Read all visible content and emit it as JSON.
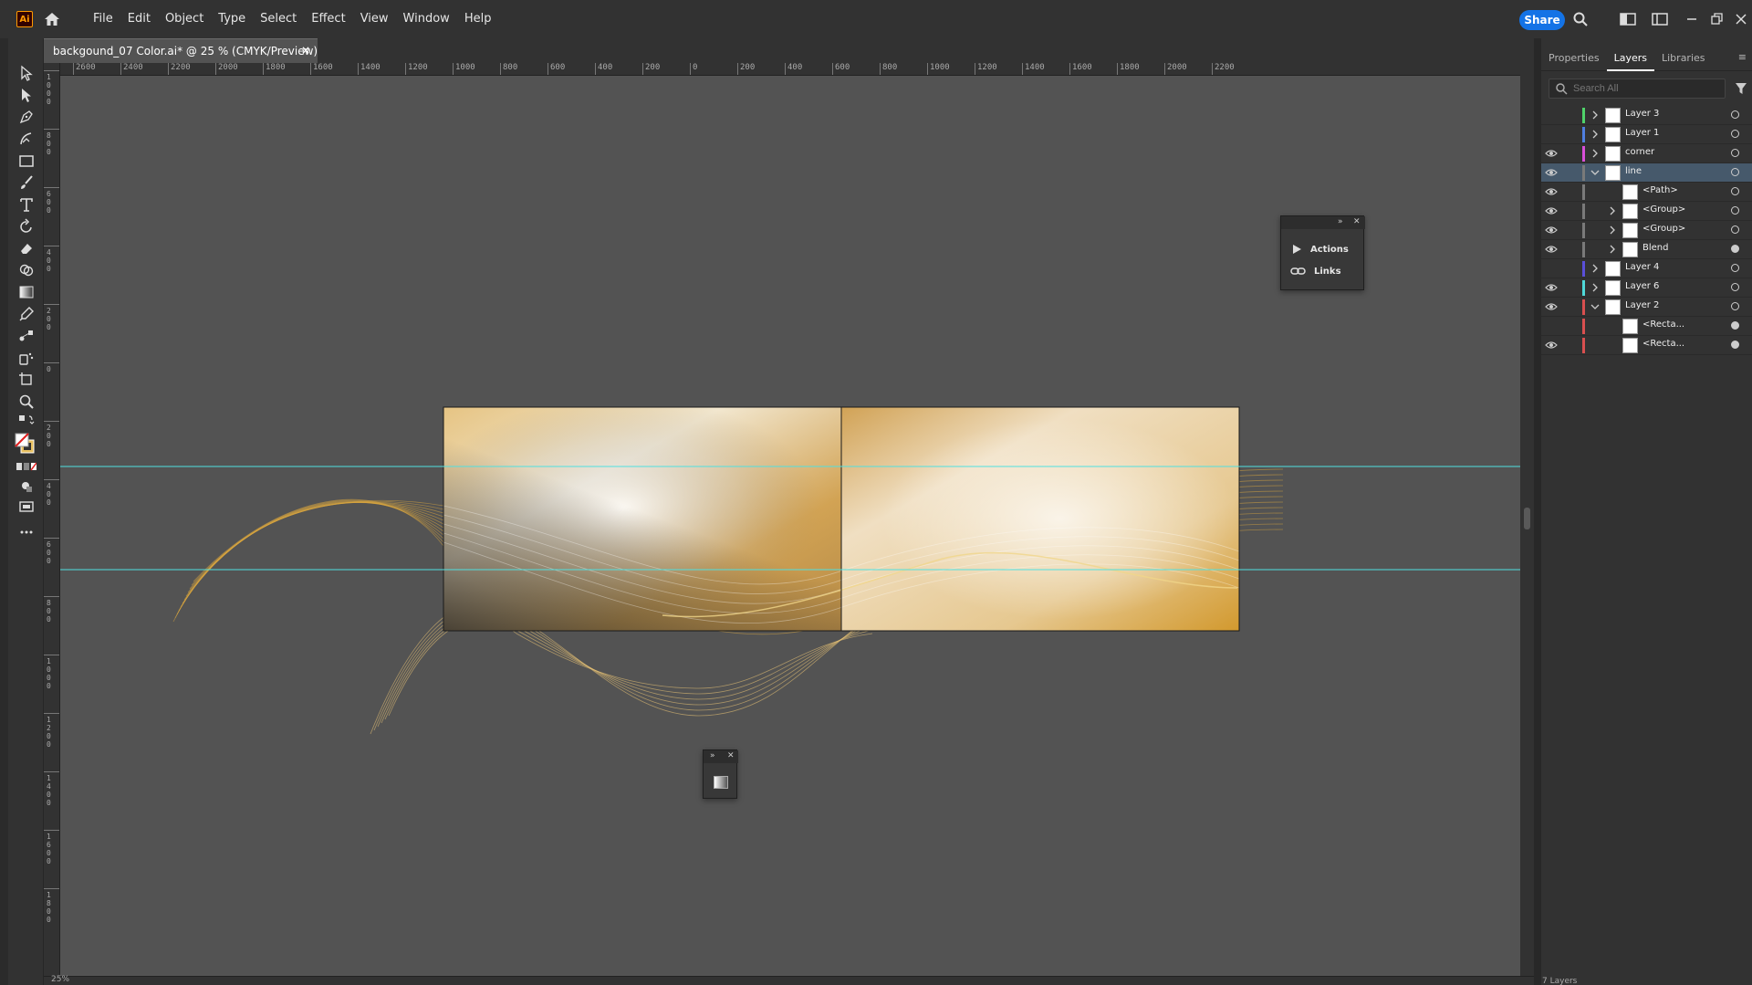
{
  "app": {
    "logo_text": "Ai",
    "share_label": "Share"
  },
  "menus": [
    "File",
    "Edit",
    "Object",
    "Type",
    "Select",
    "Effect",
    "View",
    "Window",
    "Help"
  ],
  "document": {
    "tab_title": "backgound_07 Color.ai* @ 25 % (CMYK/Preview)",
    "close_label": "×"
  },
  "ruler_h_labels": [
    "2600",
    "2400",
    "2200",
    "2000",
    "1800",
    "1600",
    "1400",
    "1200",
    "1000",
    "800",
    "600",
    "400",
    "200",
    "0",
    "200",
    "400",
    "600",
    "800",
    "1000",
    "1200",
    "1400",
    "1600",
    "1800",
    "2000",
    "2200"
  ],
  "ruler_v_labels": [
    "1000",
    "800",
    "600",
    "400",
    "200",
    "0",
    "200",
    "400",
    "600",
    "800",
    "1000",
    "1200",
    "1400",
    "1600",
    "1800"
  ],
  "panel": {
    "tabs": [
      "Properties",
      "Layers",
      "Libraries"
    ],
    "active_tab": "Layers",
    "search_placeholder": "Search All",
    "layers_count": "7 Layers"
  },
  "layers": [
    {
      "name": "Layer 3",
      "color": "#4fd36a",
      "visible": false,
      "level": 0,
      "expanded": false,
      "selected": false,
      "target_filled": false
    },
    {
      "name": "Layer 1",
      "color": "#4f7fe0",
      "visible": false,
      "level": 0,
      "expanded": false,
      "selected": false,
      "target_filled": false
    },
    {
      "name": "corner",
      "color": "#d94fd9",
      "visible": true,
      "level": 0,
      "expanded": false,
      "selected": false,
      "target_filled": false
    },
    {
      "name": "line",
      "color": "#7a7a7a",
      "visible": true,
      "level": 0,
      "expanded": true,
      "selected": true,
      "target_filled": false
    },
    {
      "name": "<Path>",
      "color": "#7a7a7a",
      "visible": true,
      "level": 1,
      "expandable": false,
      "selected": false,
      "target_filled": false
    },
    {
      "name": "<Group>",
      "color": "#7a7a7a",
      "visible": true,
      "level": 1,
      "expandable": true,
      "selected": false,
      "target_filled": false
    },
    {
      "name": "<Group>",
      "color": "#7a7a7a",
      "visible": true,
      "level": 1,
      "expandable": true,
      "selected": false,
      "target_filled": false
    },
    {
      "name": "Blend",
      "color": "#7a7a7a",
      "visible": true,
      "level": 1,
      "expandable": true,
      "selected": false,
      "target_filled": true
    },
    {
      "name": "Layer 4",
      "color": "#5a4fd9",
      "visible": false,
      "level": 0,
      "expanded": false,
      "selected": false,
      "target_filled": false
    },
    {
      "name": "Layer 6",
      "color": "#4fd9d9",
      "visible": true,
      "level": 0,
      "expanded": false,
      "selected": false,
      "target_filled": false
    },
    {
      "name": "Layer 2",
      "color": "#d94f4f",
      "visible": true,
      "level": 0,
      "expanded": true,
      "selected": false,
      "target_filled": false
    },
    {
      "name": "<Recta...",
      "color": "#d94f4f",
      "visible": false,
      "level": 1,
      "expandable": false,
      "selected": false,
      "target_filled": true
    },
    {
      "name": "<Recta...",
      "color": "#d94f4f",
      "visible": true,
      "level": 1,
      "expandable": false,
      "selected": false,
      "target_filled": true
    }
  ],
  "float_panel": {
    "actions_label": "Actions",
    "links_label": "Links"
  },
  "status": {
    "zoom": "25%"
  },
  "colors": {
    "guide": "#4fe0e0",
    "gold": "#d9a640",
    "accent": "#1473e6"
  }
}
